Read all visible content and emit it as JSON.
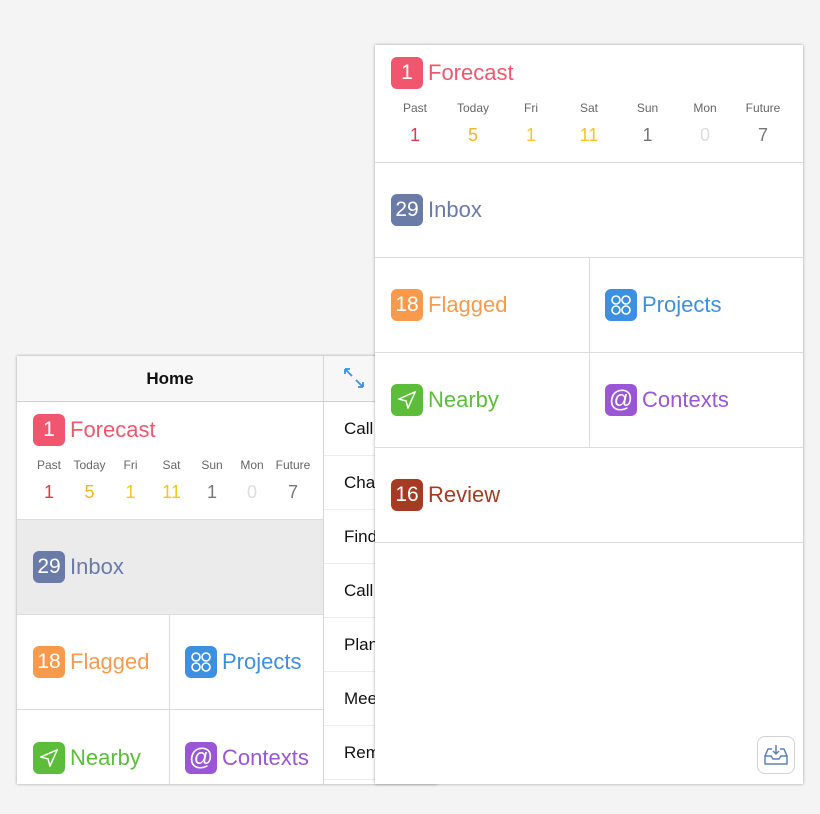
{
  "back_panel": {
    "header_title": "Home",
    "forecast": {
      "count": "1",
      "label": "Forecast",
      "days": [
        {
          "day": "Past",
          "count": "1"
        },
        {
          "day": "Today",
          "count": "5"
        },
        {
          "day": "Fri",
          "count": "1"
        },
        {
          "day": "Sat",
          "count": "11"
        },
        {
          "day": "Sun",
          "count": "1"
        },
        {
          "day": "Mon",
          "count": "0"
        },
        {
          "day": "Future",
          "count": "7"
        }
      ]
    },
    "inbox": {
      "count": "29",
      "label": "Inbox"
    },
    "flagged": {
      "count": "18",
      "label": "Flagged"
    },
    "projects": {
      "label": "Projects"
    },
    "nearby": {
      "label": "Nearby"
    },
    "contexts": {
      "label": "Contexts"
    },
    "detail_items": [
      "Call",
      "Cha",
      "Find",
      "Call",
      "Plan",
      "Mee",
      "Rem"
    ]
  },
  "front_panel": {
    "forecast": {
      "count": "1",
      "label": "Forecast",
      "days": [
        {
          "day": "Past",
          "count": "1"
        },
        {
          "day": "Today",
          "count": "5"
        },
        {
          "day": "Fri",
          "count": "1"
        },
        {
          "day": "Sat",
          "count": "11"
        },
        {
          "day": "Sun",
          "count": "1"
        },
        {
          "day": "Mon",
          "count": "0"
        },
        {
          "day": "Future",
          "count": "7"
        }
      ]
    },
    "inbox": {
      "count": "29",
      "label": "Inbox"
    },
    "flagged": {
      "count": "18",
      "label": "Flagged"
    },
    "projects": {
      "label": "Projects"
    },
    "nearby": {
      "label": "Nearby"
    },
    "contexts": {
      "label": "Contexts"
    },
    "review": {
      "count": "16",
      "label": "Review"
    }
  },
  "colors": {
    "forecast": "#f0566e",
    "inbox": "#6b7ba8",
    "flagged": "#f79a4c",
    "projects": "#3d8fe0",
    "nearby": "#5bbd3a",
    "contexts": "#9a56d4",
    "review": "#a63a22",
    "count_past": "#e0394f",
    "count_today": "#f3b623",
    "count_fri": "#f3c623",
    "count_sat": "#f3c623",
    "count_sun": "#777777",
    "count_mon": "#dddddd",
    "count_future": "#777777"
  },
  "icons": {
    "expand": "expand-arrows-icon",
    "projects": "projects-circles-icon",
    "nearby": "location-arrow-icon",
    "contexts": "at-sign-icon",
    "inbox_tray": "inbox-tray-icon"
  }
}
